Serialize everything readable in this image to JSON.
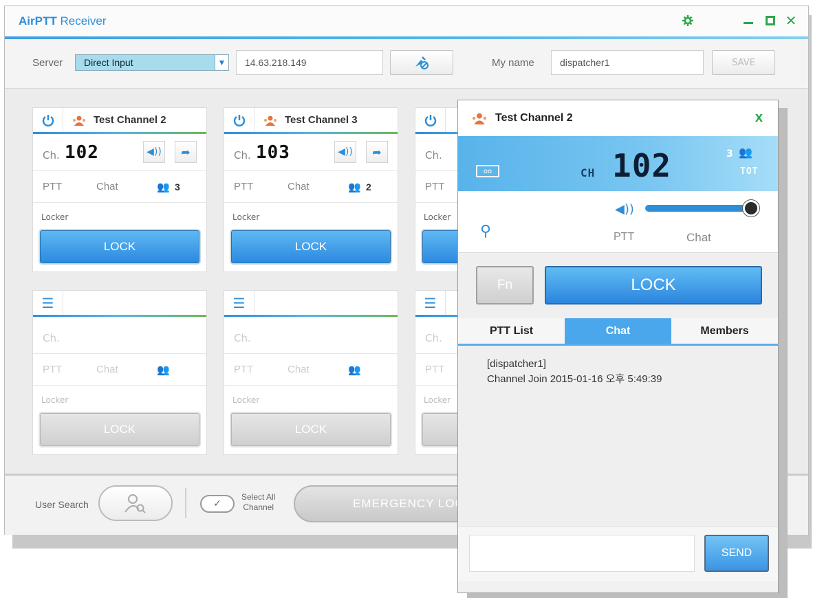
{
  "app": {
    "title_bold": "AirPTT",
    "title_rest": " Receiver"
  },
  "window_controls": [
    "settings-icon",
    "minimize-icon",
    "maximize-icon",
    "close-icon"
  ],
  "toolbar": {
    "server_label": "Server",
    "server_value": "Direct Input",
    "ip_value": "14.63.218.149",
    "myname_label": "My name",
    "myname_value": "dispatcher1",
    "save_label": "SAVE"
  },
  "channels": [
    {
      "name": "Test Channel 2",
      "ch_label": "Ch.",
      "ch_num": "102",
      "ptt": "PTT",
      "chat": "Chat",
      "members": "3",
      "locker": "Locker",
      "lock": "LOCK"
    },
    {
      "name": "Test Channel 3",
      "ch_label": "Ch.",
      "ch_num": "103",
      "ptt": "PTT",
      "chat": "Chat",
      "members": "2",
      "locker": "Locker",
      "lock": "LOCK"
    },
    {
      "name": "",
      "ch_label": "Ch.",
      "ch_num": "",
      "ptt": "PTT",
      "chat": "",
      "members": "",
      "locker": "Locker",
      "lock": ""
    }
  ],
  "empty_slots": [
    {
      "ch_label": "Ch.",
      "ptt": "PTT",
      "chat": "Chat",
      "locker": "Locker",
      "lock": "LOCK"
    },
    {
      "ch_label": "Ch.",
      "ptt": "PTT",
      "chat": "Chat",
      "locker": "Locker",
      "lock": "LOCK"
    },
    {
      "ch_label": "Ch.",
      "ptt": "PTT",
      "chat": "",
      "locker": "Locker",
      "lock": ""
    }
  ],
  "bottom": {
    "user_search_label": "User Search",
    "select_all_line1": "Select All",
    "select_all_line2": "Channel",
    "emergency_label": "EMERGENCY LOC"
  },
  "popup": {
    "title": "Test Channel 2",
    "close": "x",
    "ch_prefix": "CH",
    "ch_num": "102",
    "member_count": "3",
    "tot": "TOT",
    "ptt": "PTT",
    "chat": "Chat",
    "fn": "Fn",
    "lock": "LOCK",
    "volume_level": 1.0,
    "tabs": [
      "PTT List",
      "Chat",
      "Members"
    ],
    "active_tab": "Chat",
    "messages": [
      {
        "sender": "[dispatcher1]",
        "text": "Channel Join  2015-01-16 오후 5:49:39"
      }
    ],
    "send": "SEND"
  },
  "colors": {
    "accent": "#2d8ed8",
    "lock_blue": "#3b9be8",
    "green": "#2ea64a",
    "orange": "#e8733a"
  }
}
